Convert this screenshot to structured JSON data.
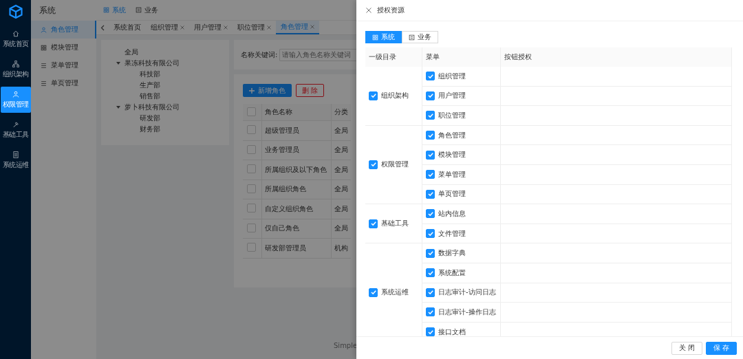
{
  "sidebar": {
    "items": [
      {
        "label": "系统首页",
        "selected": false
      },
      {
        "label": "组织架构",
        "selected": false
      },
      {
        "label": "权限管理",
        "selected": true
      },
      {
        "label": "基础工具",
        "selected": false
      },
      {
        "label": "系统运维",
        "selected": false
      }
    ]
  },
  "module_title": "系统",
  "top_nav": [
    {
      "label": "系统",
      "selected": true
    },
    {
      "label": "业务",
      "selected": false
    }
  ],
  "sub_nav": [
    {
      "label": "角色管理",
      "selected": true
    },
    {
      "label": "模块管理",
      "selected": false
    },
    {
      "label": "菜单管理",
      "selected": false
    },
    {
      "label": "单页管理",
      "selected": false
    }
  ],
  "tabs": [
    {
      "label": "系统首页",
      "closable": false,
      "selected": false
    },
    {
      "label": "组织管理",
      "closable": true,
      "selected": false
    },
    {
      "label": "用户管理",
      "closable": true,
      "selected": false
    },
    {
      "label": "职位管理",
      "closable": true,
      "selected": false
    },
    {
      "label": "角色管理",
      "closable": true,
      "selected": true
    }
  ],
  "tree": [
    {
      "label": "全局"
    },
    {
      "label": "果冻科技有限公司",
      "expanded": true,
      "children": [
        {
          "label": "科技部"
        },
        {
          "label": "生产部"
        },
        {
          "label": "销售部"
        }
      ]
    },
    {
      "label": "萝卜科技有限公司",
      "expanded": true,
      "children": [
        {
          "label": "研发部"
        },
        {
          "label": "财务部"
        }
      ]
    }
  ],
  "search": {
    "label": "名称关键词:",
    "placeholder": "请输入角色名称关键词"
  },
  "add_button": "新增角色",
  "delete_button": "删 除",
  "roles_table": {
    "columns": [
      "角色名称",
      "分类"
    ],
    "all_checked": false,
    "rows": [
      {
        "name": "超级管理员",
        "category": "全局",
        "checked": false
      },
      {
        "name": "业务管理员",
        "category": "全局",
        "checked": false
      },
      {
        "name": "所属组织及以下角色",
        "category": "全局",
        "checked": false
      },
      {
        "name": "所属组织角色",
        "category": "全局",
        "checked": false
      },
      {
        "name": "自定义组织角色",
        "category": "全局",
        "checked": false
      },
      {
        "name": "仅自己角色",
        "category": "全局",
        "checked": false
      },
      {
        "name": "研发部管理员",
        "category": "机构",
        "checked": false
      }
    ]
  },
  "footer_text": "Simple",
  "drawer": {
    "title": "授权资源",
    "tabs": [
      {
        "label": "系统",
        "selected": true
      },
      {
        "label": "业务",
        "selected": false
      }
    ],
    "columns": [
      "一级目录",
      "菜单",
      "按钮授权"
    ],
    "groups": [
      {
        "label": "组织架构",
        "checked": true,
        "menus": [
          {
            "label": "组织管理",
            "checked": true
          },
          {
            "label": "用户管理",
            "checked": true
          },
          {
            "label": "职位管理",
            "checked": true
          }
        ]
      },
      {
        "label": "权限管理",
        "checked": true,
        "menus": [
          {
            "label": "角色管理",
            "checked": true
          },
          {
            "label": "模块管理",
            "checked": true
          },
          {
            "label": "菜单管理",
            "checked": true
          },
          {
            "label": "单页管理",
            "checked": true
          }
        ]
      },
      {
        "label": "基础工具",
        "checked": true,
        "menus": [
          {
            "label": "站内信息",
            "checked": true
          },
          {
            "label": "文件管理",
            "checked": true
          }
        ]
      },
      {
        "label": "系统运维",
        "checked": true,
        "menus": [
          {
            "label": "数据字典",
            "checked": true
          },
          {
            "label": "系统配置",
            "checked": true
          },
          {
            "label": "日志审计-访问日志",
            "checked": true
          },
          {
            "label": "日志审计-操作日志",
            "checked": true
          },
          {
            "label": "接口文档",
            "checked": true
          }
        ]
      }
    ],
    "close_button": "关 闭",
    "save_button": "保 存"
  }
}
